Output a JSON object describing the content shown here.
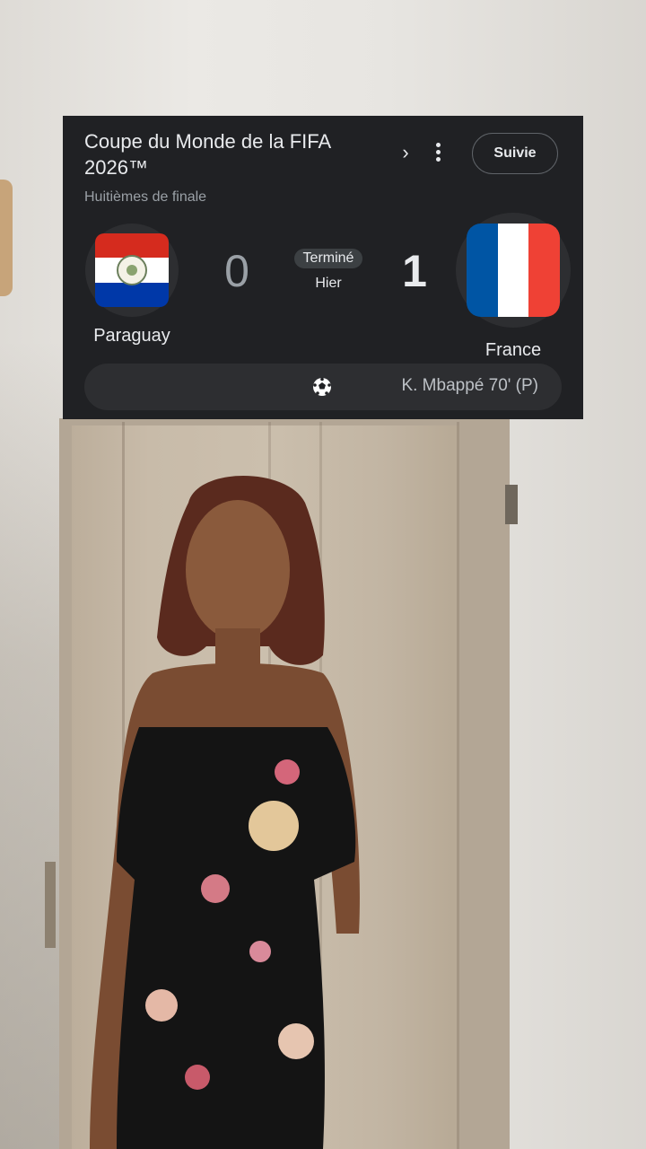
{
  "match_card": {
    "competition": "Coupe du Monde de la FIFA 2026™",
    "stage": "Huitièmes de finale",
    "follow_label": "Suivie",
    "home": {
      "name": "Paraguay",
      "score": "0",
      "flag": "paraguay-flag"
    },
    "away": {
      "name": "France",
      "score": "1",
      "flag": "france-flag"
    },
    "status": "Terminé",
    "day": "Hier",
    "scorers": "K. Mbappé 70' (P)"
  },
  "colors": {
    "card_bg": "#202124",
    "text_primary": "#e8eaed",
    "text_secondary": "#9aa0a6",
    "pill_bg": "#2d2e31"
  },
  "icons": {
    "chevron": "chevron-right-icon",
    "more": "more-vert-icon",
    "ball": "soccer-ball-icon"
  }
}
